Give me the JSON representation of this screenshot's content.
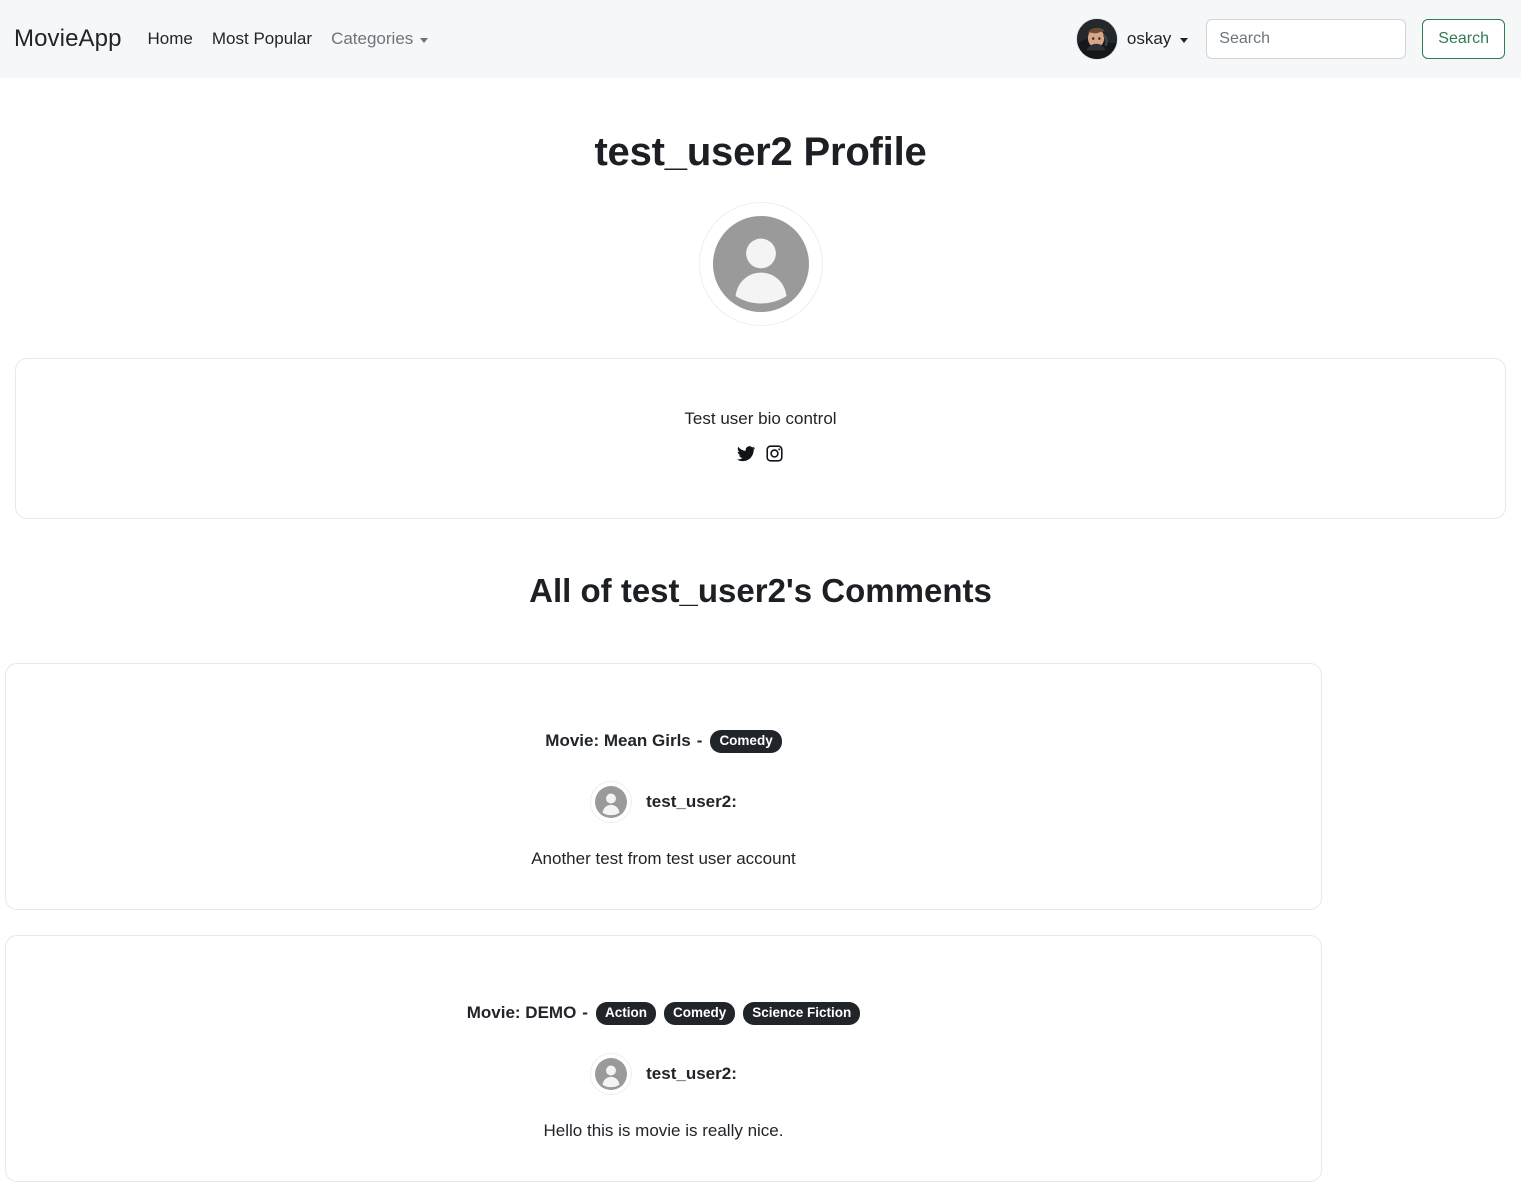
{
  "navbar": {
    "brand": "MovieApp",
    "links": [
      {
        "label": "Home",
        "muted": false,
        "caret": false
      },
      {
        "label": "Most Popular",
        "muted": false,
        "caret": false
      },
      {
        "label": "Categories",
        "muted": true,
        "caret": true
      }
    ],
    "user": {
      "name": "oskay",
      "avatar_icon": "user-photo-avatar",
      "caret": true
    },
    "search": {
      "placeholder": "Search",
      "value": "",
      "button_label": "Search"
    },
    "colors": {
      "navbar_bg": "#f6f7f9",
      "accent_green": "#2f7d52",
      "badge_bg": "#212529"
    }
  },
  "profile": {
    "title": "test_user2 Profile",
    "avatar_icon": "person-placeholder-icon",
    "bio": "Test user bio control",
    "social_links": [
      {
        "name": "twitter-icon",
        "label": "Twitter"
      },
      {
        "name": "instagram-icon",
        "label": "Instagram"
      }
    ]
  },
  "comments_section": {
    "heading": "All of test_user2's Comments",
    "comments": [
      {
        "movie_label": "Movie: Mean Girls",
        "separator": "-",
        "genres": [
          "Comedy"
        ],
        "author": "test_user2:",
        "author_avatar_icon": "person-placeholder-icon",
        "text": "Another test from test user account"
      },
      {
        "movie_label": "Movie: DEMO",
        "separator": "-",
        "genres": [
          "Action",
          "Comedy",
          "Science Fiction"
        ],
        "author": "test_user2:",
        "author_avatar_icon": "person-placeholder-icon",
        "text": "Hello this is movie is really nice."
      }
    ]
  }
}
